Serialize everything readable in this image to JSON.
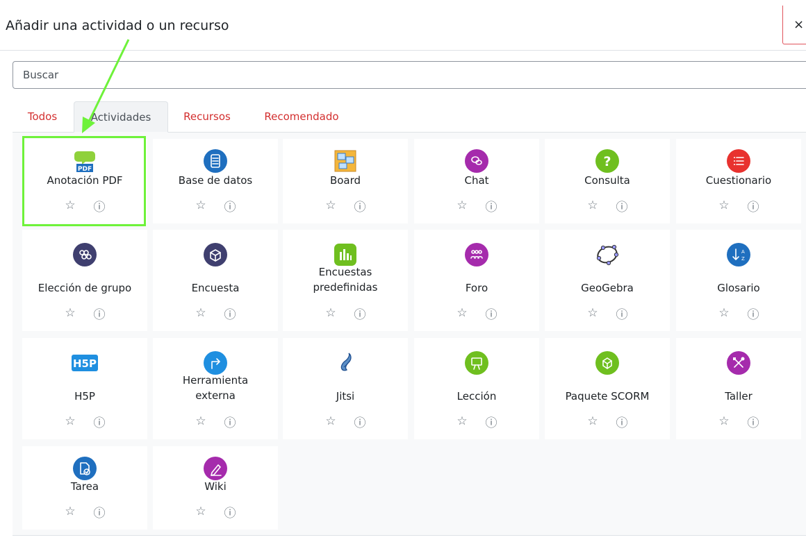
{
  "modal": {
    "title": "Añadir una actividad o un recurso",
    "close_label": "×"
  },
  "search": {
    "placeholder": "Buscar",
    "value": ""
  },
  "tabs": [
    {
      "label": "Todos",
      "active": false
    },
    {
      "label": "Actividades",
      "active": true
    },
    {
      "label": "Recursos",
      "active": false
    },
    {
      "label": "Recomendado",
      "active": false
    }
  ],
  "actions": {
    "star": "☆",
    "info": "ⓘ"
  },
  "modules": [
    {
      "label": "Anotación PDF",
      "icon": "pdf-annotation-icon",
      "color": "#1f6fbf"
    },
    {
      "label": "Base de datos",
      "icon": "database-icon",
      "color": "#1f6fbf"
    },
    {
      "label": "Board",
      "icon": "board-icon",
      "color": "#f4b63b"
    },
    {
      "label": "Chat",
      "icon": "chat-icon",
      "color": "#a52bac"
    },
    {
      "label": "Consulta",
      "icon": "question-icon",
      "color": "#6fbf1f"
    },
    {
      "label": "Cuestionario",
      "icon": "quiz-list-icon",
      "color": "#e8322f"
    },
    {
      "label": "Elección de grupo",
      "icon": "group-choice-icon",
      "color": "#3f3f6f"
    },
    {
      "label": "Encuesta",
      "icon": "survey-box-icon",
      "color": "#3f3f6f"
    },
    {
      "label": "Encuestas predefinidas",
      "icon": "bar-chart-icon",
      "color": "#6fbf1f"
    },
    {
      "label": "Foro",
      "icon": "forum-people-icon",
      "color": "#a52bac"
    },
    {
      "label": "GeoGebra",
      "icon": "geogebra-icon",
      "color": "#6557d2"
    },
    {
      "label": "Glosario",
      "icon": "glossary-sort-icon",
      "color": "#1f6fbf"
    },
    {
      "label": "H5P",
      "icon": "h5p-icon",
      "color": "#1f8fe0"
    },
    {
      "label": "Herramienta externa",
      "icon": "external-tool-icon",
      "color": "#1f8fe0"
    },
    {
      "label": "Jitsi",
      "icon": "jitsi-icon",
      "color": "#1f6fbf"
    },
    {
      "label": "Lección",
      "icon": "lesson-board-icon",
      "color": "#6fbf1f"
    },
    {
      "label": "Paquete SCORM",
      "icon": "scorm-package-icon",
      "color": "#6fbf1f"
    },
    {
      "label": "Taller",
      "icon": "workshop-tools-icon",
      "color": "#a52bac"
    },
    {
      "label": "Tarea",
      "icon": "assignment-icon",
      "color": "#1f6fbf"
    },
    {
      "label": "Wiki",
      "icon": "wiki-pen-icon",
      "color": "#a52bac"
    }
  ]
}
